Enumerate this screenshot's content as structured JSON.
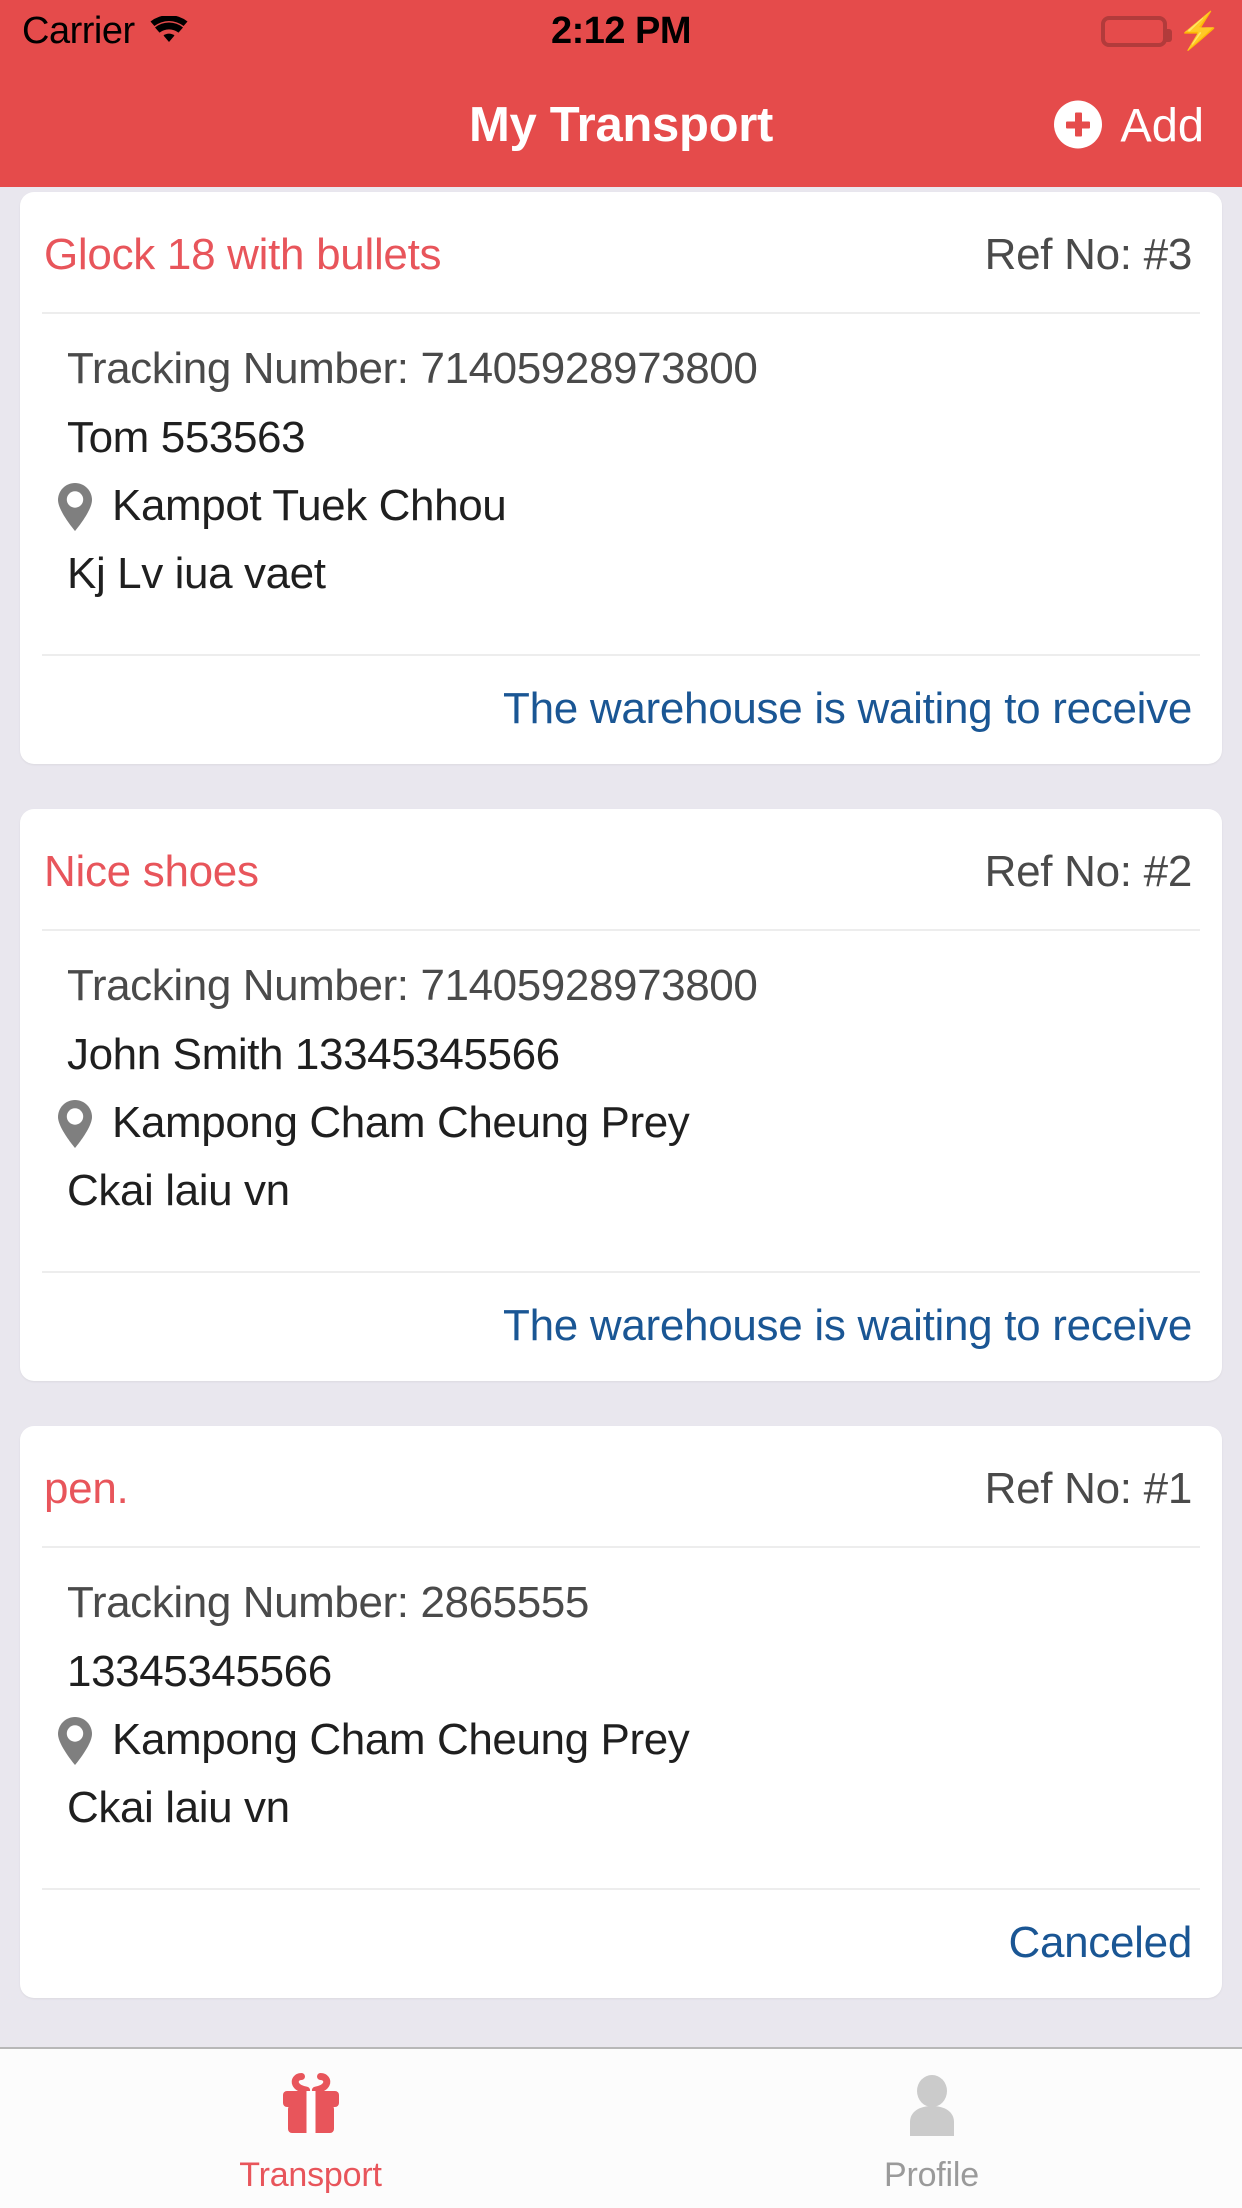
{
  "statusbar": {
    "carrier": "Carrier",
    "wifi_icon": "wifi-icon",
    "time": "2:12 PM",
    "battery_icon": "battery-icon",
    "charging_icon": "lightning-bolt-icon",
    "battery_color": "#4CD964"
  },
  "navbar": {
    "title": "My Transport",
    "add_label": "Add",
    "add_icon": "plus-circle-icon",
    "background_color": "#E54B4B",
    "title_color": "#FFFFFF"
  },
  "colors": {
    "accent_red": "#E8555B",
    "status_blue": "#1A5694",
    "page_background": "#E9E7EE",
    "card_background": "#FFFFFF"
  },
  "list": {
    "tracking_label": "Tracking Number: ",
    "ref_label": "Ref No: ",
    "pin_icon": "map-pin-icon",
    "items": [
      {
        "title": "Glock 18 with bullets",
        "ref": "Ref No: #3",
        "tracking": "Tracking Number: 71405928973800",
        "recipient": "Tom 553563",
        "location": "Kampot Tuek Chhou",
        "address": "Kj Lv iua vaet",
        "status": "The warehouse is waiting to receive"
      },
      {
        "title": "Nice shoes",
        "ref": "Ref No: #2",
        "tracking": "Tracking Number: 71405928973800",
        "recipient": "John Smith 13345345566",
        "location": "Kampong Cham Cheung Prey",
        "address": "Ckai laiu vn",
        "status": "The warehouse is waiting to receive"
      },
      {
        "title": "pen.",
        "ref": "Ref No: #1",
        "tracking": "Tracking Number: 2865555",
        "recipient": " 13345345566",
        "location": "Kampong Cham Cheung Prey",
        "address": "Ckai laiu vn",
        "status": "Canceled"
      }
    ]
  },
  "tabbar": {
    "tabs": [
      {
        "label": "Transport",
        "icon": "gift-icon",
        "active": true
      },
      {
        "label": "Profile",
        "icon": "person-icon",
        "active": false
      }
    ]
  }
}
